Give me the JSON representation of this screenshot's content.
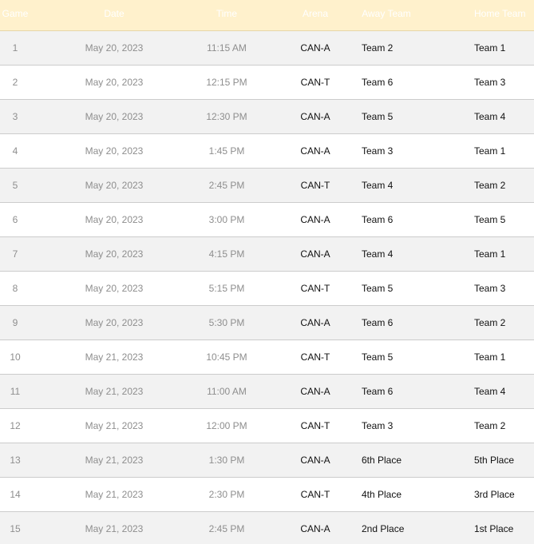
{
  "header": {
    "game": "Game",
    "date": "Date",
    "time": "Time",
    "arena": "Arena",
    "away": "Away Team",
    "home": "Home Team"
  },
  "rows": [
    {
      "game": "1",
      "date": "May 20, 2023",
      "time": "11:15 AM",
      "arena": "CAN-A",
      "away": "Team 2",
      "home": "Team 1"
    },
    {
      "game": "2",
      "date": "May 20, 2023",
      "time": "12:15 PM",
      "arena": "CAN-T",
      "away": "Team 6",
      "home": "Team 3"
    },
    {
      "game": "3",
      "date": "May 20, 2023",
      "time": "12:30 PM",
      "arena": "CAN-A",
      "away": "Team 5",
      "home": "Team 4"
    },
    {
      "game": "4",
      "date": "May 20, 2023",
      "time": "1:45 PM",
      "arena": "CAN-A",
      "away": "Team 3",
      "home": "Team 1"
    },
    {
      "game": "5",
      "date": "May 20, 2023",
      "time": "2:45 PM",
      "arena": "CAN-T",
      "away": "Team 4",
      "home": "Team 2"
    },
    {
      "game": "6",
      "date": "May 20, 2023",
      "time": "3:00 PM",
      "arena": "CAN-A",
      "away": "Team 6",
      "home": "Team 5"
    },
    {
      "game": "7",
      "date": "May 20, 2023",
      "time": "4:15 PM",
      "arena": "CAN-A",
      "away": "Team 4",
      "home": "Team 1"
    },
    {
      "game": "8",
      "date": "May 20, 2023",
      "time": "5:15 PM",
      "arena": "CAN-T",
      "away": "Team 5",
      "home": "Team 3"
    },
    {
      "game": "9",
      "date": "May 20, 2023",
      "time": "5:30 PM",
      "arena": "CAN-A",
      "away": "Team 6",
      "home": "Team 2"
    },
    {
      "game": "10",
      "date": "May 21, 2023",
      "time": "10:45 PM",
      "arena": "CAN-T",
      "away": "Team 5",
      "home": "Team 1"
    },
    {
      "game": "11",
      "date": "May 21, 2023",
      "time": "11:00 AM",
      "arena": "CAN-A",
      "away": "Team 6",
      "home": "Team 4"
    },
    {
      "game": "12",
      "date": "May 21, 2023",
      "time": "12:00 PM",
      "arena": "CAN-T",
      "away": "Team 3",
      "home": "Team 2"
    },
    {
      "game": "13",
      "date": "May 21, 2023",
      "time": "1:30 PM",
      "arena": "CAN-A",
      "away": "6th Place",
      "home": "5th Place"
    },
    {
      "game": "14",
      "date": "May 21, 2023",
      "time": "2:30 PM",
      "arena": "CAN-T",
      "away": "4th Place",
      "home": "3rd Place"
    },
    {
      "game": "15",
      "date": "May 21, 2023",
      "time": "2:45 PM",
      "arena": "CAN-A",
      "away": "2nd Place",
      "home": "1st Place"
    }
  ],
  "colors": {
    "header_bg": "#fff1cc",
    "row_odd_bg": "#f2f2f2",
    "row_even_bg": "#ffffff",
    "muted_text": "#8e8e8e",
    "strong_text": "#111111"
  }
}
